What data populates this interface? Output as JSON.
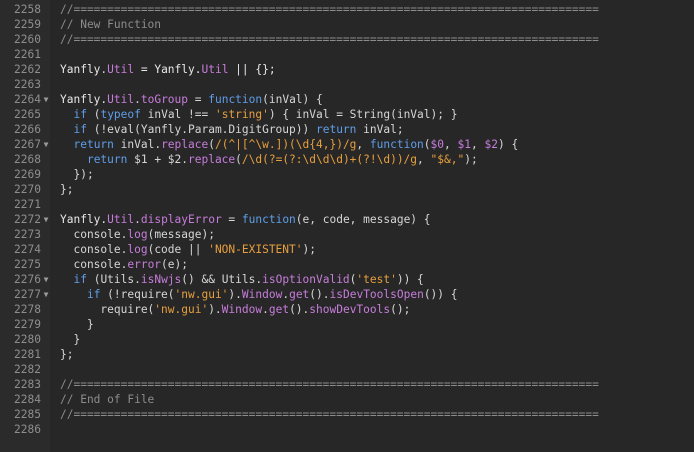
{
  "editor": {
    "lines": [
      {
        "n": "2258",
        "fold": "",
        "tokens": [
          {
            "t": "//==============================================================================",
            "c": "c"
          }
        ]
      },
      {
        "n": "2259",
        "fold": "",
        "tokens": [
          {
            "t": "// New Function",
            "c": "c"
          }
        ]
      },
      {
        "n": "2260",
        "fold": "",
        "tokens": [
          {
            "t": "//==============================================================================",
            "c": "c"
          }
        ]
      },
      {
        "n": "2261",
        "fold": "",
        "tokens": []
      },
      {
        "n": "2262",
        "fold": "",
        "tokens": [
          {
            "t": "Yanfly",
            "c": "b"
          },
          {
            "t": ".",
            "c": "p"
          },
          {
            "t": "Util",
            "c": "f"
          },
          {
            "t": " = Yanfly.",
            "c": "b"
          },
          {
            "t": "Util",
            "c": "f"
          },
          {
            "t": " || {};",
            "c": "b"
          }
        ]
      },
      {
        "n": "2263",
        "fold": "",
        "tokens": []
      },
      {
        "n": "2264",
        "fold": "▼",
        "tokens": [
          {
            "t": "Yanfly.",
            "c": "b"
          },
          {
            "t": "Util",
            "c": "f"
          },
          {
            "t": ".",
            "c": "p"
          },
          {
            "t": "toGroup",
            "c": "f"
          },
          {
            "t": " = ",
            "c": "p"
          },
          {
            "t": "function",
            "c": "k"
          },
          {
            "t": "(inVal) {",
            "c": "p"
          }
        ]
      },
      {
        "n": "2265",
        "fold": "",
        "tokens": [
          {
            "t": "  ",
            "c": "p"
          },
          {
            "t": "if",
            "c": "k"
          },
          {
            "t": " (",
            "c": "p"
          },
          {
            "t": "typeof",
            "c": "k"
          },
          {
            "t": " inVal !== ",
            "c": "p"
          },
          {
            "t": "'string'",
            "c": "s"
          },
          {
            "t": ") { inVal = String(inVal); }",
            "c": "p"
          }
        ]
      },
      {
        "n": "2266",
        "fold": "",
        "tokens": [
          {
            "t": "  ",
            "c": "p"
          },
          {
            "t": "if",
            "c": "k"
          },
          {
            "t": " (!eval(Yanfly.Param.DigitGroup)) ",
            "c": "p"
          },
          {
            "t": "return",
            "c": "k"
          },
          {
            "t": " inVal;",
            "c": "p"
          }
        ]
      },
      {
        "n": "2267",
        "fold": "▼",
        "tokens": [
          {
            "t": "  ",
            "c": "p"
          },
          {
            "t": "return",
            "c": "k"
          },
          {
            "t": " inVal.",
            "c": "p"
          },
          {
            "t": "replace",
            "c": "f"
          },
          {
            "t": "(",
            "c": "p"
          },
          {
            "t": "/(^|[^\\w.])(\\d{4,})/g",
            "c": "s"
          },
          {
            "t": ", ",
            "c": "p"
          },
          {
            "t": "function",
            "c": "k"
          },
          {
            "t": "(",
            "c": "p"
          },
          {
            "t": "$0",
            "c": "f"
          },
          {
            "t": ", ",
            "c": "p"
          },
          {
            "t": "$1",
            "c": "f"
          },
          {
            "t": ", ",
            "c": "p"
          },
          {
            "t": "$2",
            "c": "f"
          },
          {
            "t": ") {",
            "c": "p"
          }
        ]
      },
      {
        "n": "2268",
        "fold": "",
        "tokens": [
          {
            "t": "    ",
            "c": "p"
          },
          {
            "t": "return",
            "c": "k"
          },
          {
            "t": " $1 + $2.",
            "c": "p"
          },
          {
            "t": "replace",
            "c": "f"
          },
          {
            "t": "(",
            "c": "p"
          },
          {
            "t": "/\\d(?=(?:\\d\\d\\d)+(?!\\d))/g",
            "c": "s"
          },
          {
            "t": ", ",
            "c": "p"
          },
          {
            "t": "\"$&,\"",
            "c": "s"
          },
          {
            "t": ");",
            "c": "p"
          }
        ]
      },
      {
        "n": "2269",
        "fold": "",
        "tokens": [
          {
            "t": "  });",
            "c": "p"
          }
        ]
      },
      {
        "n": "2270",
        "fold": "",
        "tokens": [
          {
            "t": "};",
            "c": "p"
          }
        ]
      },
      {
        "n": "2271",
        "fold": "",
        "tokens": []
      },
      {
        "n": "2272",
        "fold": "▼",
        "tokens": [
          {
            "t": "Yanfly.",
            "c": "b"
          },
          {
            "t": "Util",
            "c": "f"
          },
          {
            "t": ".",
            "c": "p"
          },
          {
            "t": "displayError",
            "c": "f"
          },
          {
            "t": " = ",
            "c": "p"
          },
          {
            "t": "function",
            "c": "k"
          },
          {
            "t": "(e, code, message) {",
            "c": "p"
          }
        ]
      },
      {
        "n": "2273",
        "fold": "",
        "tokens": [
          {
            "t": "  console.",
            "c": "p"
          },
          {
            "t": "log",
            "c": "f"
          },
          {
            "t": "(message);",
            "c": "p"
          }
        ]
      },
      {
        "n": "2274",
        "fold": "",
        "tokens": [
          {
            "t": "  console.",
            "c": "p"
          },
          {
            "t": "log",
            "c": "f"
          },
          {
            "t": "(code || ",
            "c": "p"
          },
          {
            "t": "'NON-EXISTENT'",
            "c": "s"
          },
          {
            "t": ");",
            "c": "p"
          }
        ]
      },
      {
        "n": "2275",
        "fold": "",
        "tokens": [
          {
            "t": "  console.",
            "c": "p"
          },
          {
            "t": "error",
            "c": "f"
          },
          {
            "t": "(e);",
            "c": "p"
          }
        ]
      },
      {
        "n": "2276",
        "fold": "▼",
        "tokens": [
          {
            "t": "  ",
            "c": "p"
          },
          {
            "t": "if",
            "c": "k"
          },
          {
            "t": " (Utils.",
            "c": "p"
          },
          {
            "t": "isNwjs",
            "c": "f"
          },
          {
            "t": "() && Utils.",
            "c": "p"
          },
          {
            "t": "isOptionValid",
            "c": "f"
          },
          {
            "t": "(",
            "c": "p"
          },
          {
            "t": "'test'",
            "c": "s"
          },
          {
            "t": ")) {",
            "c": "p"
          }
        ]
      },
      {
        "n": "2277",
        "fold": "▼",
        "tokens": [
          {
            "t": "    ",
            "c": "p"
          },
          {
            "t": "if",
            "c": "k"
          },
          {
            "t": " (!require(",
            "c": "p"
          },
          {
            "t": "'nw.gui'",
            "c": "s"
          },
          {
            "t": ").",
            "c": "p"
          },
          {
            "t": "Window",
            "c": "f"
          },
          {
            "t": ".",
            "c": "p"
          },
          {
            "t": "get",
            "c": "f"
          },
          {
            "t": "().",
            "c": "p"
          },
          {
            "t": "isDevToolsOpen",
            "c": "f"
          },
          {
            "t": "()) {",
            "c": "p"
          }
        ]
      },
      {
        "n": "2278",
        "fold": "",
        "tokens": [
          {
            "t": "      require(",
            "c": "p"
          },
          {
            "t": "'nw.gui'",
            "c": "s"
          },
          {
            "t": ").",
            "c": "p"
          },
          {
            "t": "Window",
            "c": "f"
          },
          {
            "t": ".",
            "c": "p"
          },
          {
            "t": "get",
            "c": "f"
          },
          {
            "t": "().",
            "c": "p"
          },
          {
            "t": "showDevTools",
            "c": "f"
          },
          {
            "t": "();",
            "c": "p"
          }
        ]
      },
      {
        "n": "2279",
        "fold": "",
        "tokens": [
          {
            "t": "    }",
            "c": "p"
          }
        ]
      },
      {
        "n": "2280",
        "fold": "",
        "tokens": [
          {
            "t": "  }",
            "c": "p"
          }
        ]
      },
      {
        "n": "2281",
        "fold": "",
        "tokens": [
          {
            "t": "};",
            "c": "p"
          }
        ]
      },
      {
        "n": "2282",
        "fold": "",
        "tokens": []
      },
      {
        "n": "2283",
        "fold": "",
        "tokens": [
          {
            "t": "//==============================================================================",
            "c": "c"
          }
        ]
      },
      {
        "n": "2284",
        "fold": "",
        "tokens": [
          {
            "t": "// End of File",
            "c": "c"
          }
        ]
      },
      {
        "n": "2285",
        "fold": "",
        "tokens": [
          {
            "t": "//==============================================================================",
            "c": "c"
          }
        ]
      },
      {
        "n": "2286",
        "fold": "",
        "tokens": []
      }
    ]
  },
  "colors": {
    "background": "#272727",
    "gutter": "#2b2b2b",
    "comment": "#8c8c8c",
    "keyword": "#5f9ee8",
    "property": "#c77ddb",
    "string": "#e69f3e",
    "text": "#d6d6d6"
  },
  "icons": {
    "fold": "fold-arrow-icon"
  }
}
